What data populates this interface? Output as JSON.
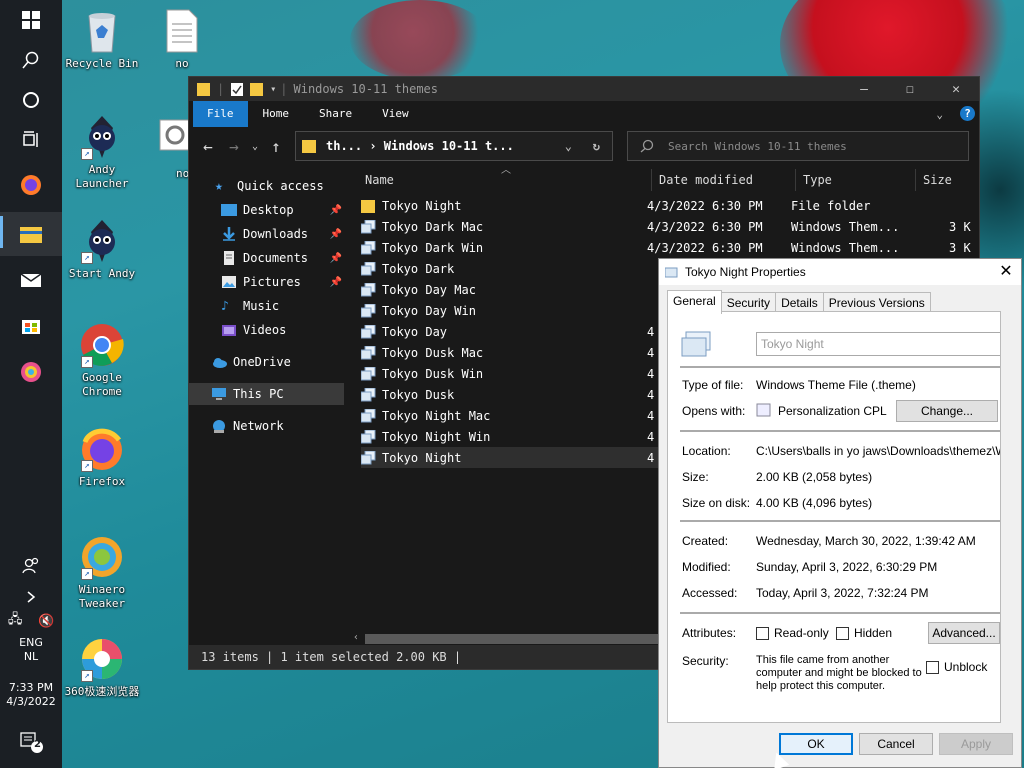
{
  "taskbar": {
    "lang": "ENG",
    "region": "NL",
    "time": "7:33 PM",
    "date": "4/3/2022",
    "notif_count": "2"
  },
  "desktop_icons": [
    {
      "label": "Recycle Bin",
      "icon": "recycle-bin-icon"
    },
    {
      "label": "no",
      "icon": "text-file-icon"
    },
    {
      "label": "no",
      "icon": "settings-file-icon"
    },
    {
      "label": "Andy Launcher",
      "icon": "andy-icon"
    },
    {
      "label": "Start Andy",
      "icon": "andy-icon"
    },
    {
      "label": "Google Chrome",
      "icon": "chrome-icon"
    },
    {
      "label": "Firefox",
      "icon": "firefox-icon"
    },
    {
      "label": "Winaero Tweaker",
      "icon": "winaero-icon"
    },
    {
      "label": "360极速浏览器",
      "icon": "360-browser-icon"
    }
  ],
  "explorer": {
    "title": "Windows 10-11 themes",
    "ribbon_tabs": [
      "File",
      "Home",
      "Share",
      "View"
    ],
    "address": "th...  ›  Windows 10-11 t...",
    "search_placeholder": "Search Windows 10-11 themes",
    "columns": {
      "name": "Name",
      "date": "Date modified",
      "type": "Type",
      "size": "Size"
    },
    "nav": {
      "quick_access": "Quick access",
      "desktop": "Desktop",
      "downloads": "Downloads",
      "documents": "Documents",
      "pictures": "Pictures",
      "music": "Music",
      "videos": "Videos",
      "onedrive": "OneDrive",
      "this_pc": "This PC",
      "network": "Network"
    },
    "files": [
      {
        "name": "Tokyo Night",
        "date": "4/3/2022 6:30 PM",
        "type": "File folder",
        "size": "",
        "kind": "folder"
      },
      {
        "name": "Tokyo Dark Mac",
        "date": "4/3/2022 6:30 PM",
        "type": "Windows Them...",
        "size": "3 K",
        "kind": "theme"
      },
      {
        "name": "Tokyo Dark Win",
        "date": "4/3/2022 6:30 PM",
        "type": "Windows Them...",
        "size": "3 K",
        "kind": "theme"
      },
      {
        "name": "Tokyo Dark",
        "date": "",
        "type": "",
        "size": "",
        "kind": "theme"
      },
      {
        "name": "Tokyo Day Mac",
        "date": "",
        "type": "",
        "size": "",
        "kind": "theme"
      },
      {
        "name": "Tokyo Day Win",
        "date": "",
        "type": "",
        "size": "",
        "kind": "theme"
      },
      {
        "name": "Tokyo Day",
        "date": "4",
        "type": "",
        "size": "",
        "kind": "theme"
      },
      {
        "name": "Tokyo Dusk Mac",
        "date": "4",
        "type": "",
        "size": "",
        "kind": "theme"
      },
      {
        "name": "Tokyo Dusk Win",
        "date": "4",
        "type": "",
        "size": "",
        "kind": "theme"
      },
      {
        "name": "Tokyo Dusk",
        "date": "4",
        "type": "",
        "size": "",
        "kind": "theme"
      },
      {
        "name": "Tokyo Night Mac",
        "date": "4",
        "type": "",
        "size": "",
        "kind": "theme"
      },
      {
        "name": "Tokyo Night Win",
        "date": "4",
        "type": "",
        "size": "",
        "kind": "theme"
      },
      {
        "name": "Tokyo Night",
        "date": "4",
        "type": "",
        "size": "",
        "kind": "theme"
      }
    ],
    "status": "13 items  |  1 item selected  2.00 KB  |"
  },
  "properties": {
    "title": "Tokyo Night Properties",
    "tabs": [
      "General",
      "Security",
      "Details",
      "Previous Versions"
    ],
    "name_value": "Tokyo Night",
    "type_label": "Type of file:",
    "type_value": "Windows Theme File (.theme)",
    "opens_label": "Opens with:",
    "opens_value": "Personalization CPL",
    "change_btn": "Change...",
    "location_label": "Location:",
    "location_value": "C:\\Users\\balls in yo jaws\\Downloads\\themez\\Windo",
    "size_label": "Size:",
    "size_value": "2.00 KB (2,058 bytes)",
    "sizeondisk_label": "Size on disk:",
    "sizeondisk_value": "4.00 KB (4,096 bytes)",
    "created_label": "Created:",
    "created_value": "Wednesday, March 30, 2022, 1:39:42 AM",
    "modified_label": "Modified:",
    "modified_value": "Sunday, April 3, 2022, 6:30:29 PM",
    "accessed_label": "Accessed:",
    "accessed_value": "Today, April 3, 2022, 7:32:24 PM",
    "attributes_label": "Attributes:",
    "readonly": "Read-only",
    "hidden": "Hidden",
    "advanced_btn": "Advanced...",
    "security_label": "Security:",
    "security_text_1": "This file came from another",
    "security_text_2": "computer and might be blocked to",
    "security_text_3": "help protect this computer.",
    "unblock": "Unblock",
    "ok": "OK",
    "cancel": "Cancel",
    "apply": "Apply"
  }
}
